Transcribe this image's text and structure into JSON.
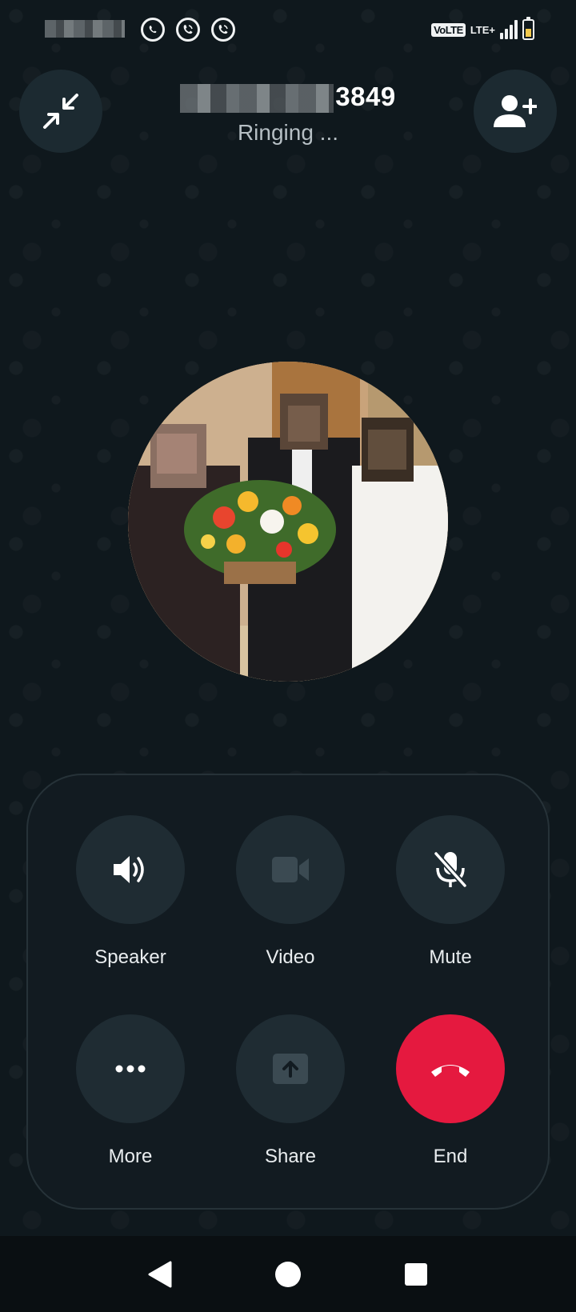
{
  "status_bar": {
    "volte": "VoLTE",
    "network": "LTE+",
    "signal_level": 4,
    "battery_level": 0.55,
    "notification_icons": [
      "whatsapp-icon",
      "whatsapp-call-icon",
      "whatsapp-call-icon"
    ]
  },
  "header": {
    "caller_number_visible": "3849",
    "call_status": "Ringing ..."
  },
  "controls": [
    {
      "label": "Speaker",
      "icon": "speaker-icon"
    },
    {
      "label": "Video",
      "icon": "video-camera-icon"
    },
    {
      "label": "Mute",
      "icon": "mic-off-icon"
    },
    {
      "label": "More",
      "icon": "more-dots-icon"
    },
    {
      "label": "Share",
      "icon": "share-screen-icon"
    },
    {
      "label": "End",
      "icon": "end-call-icon"
    }
  ],
  "colors": {
    "end_call": "#e5193f",
    "panel_background": "#121b21",
    "button_background": "#1f2c33"
  }
}
